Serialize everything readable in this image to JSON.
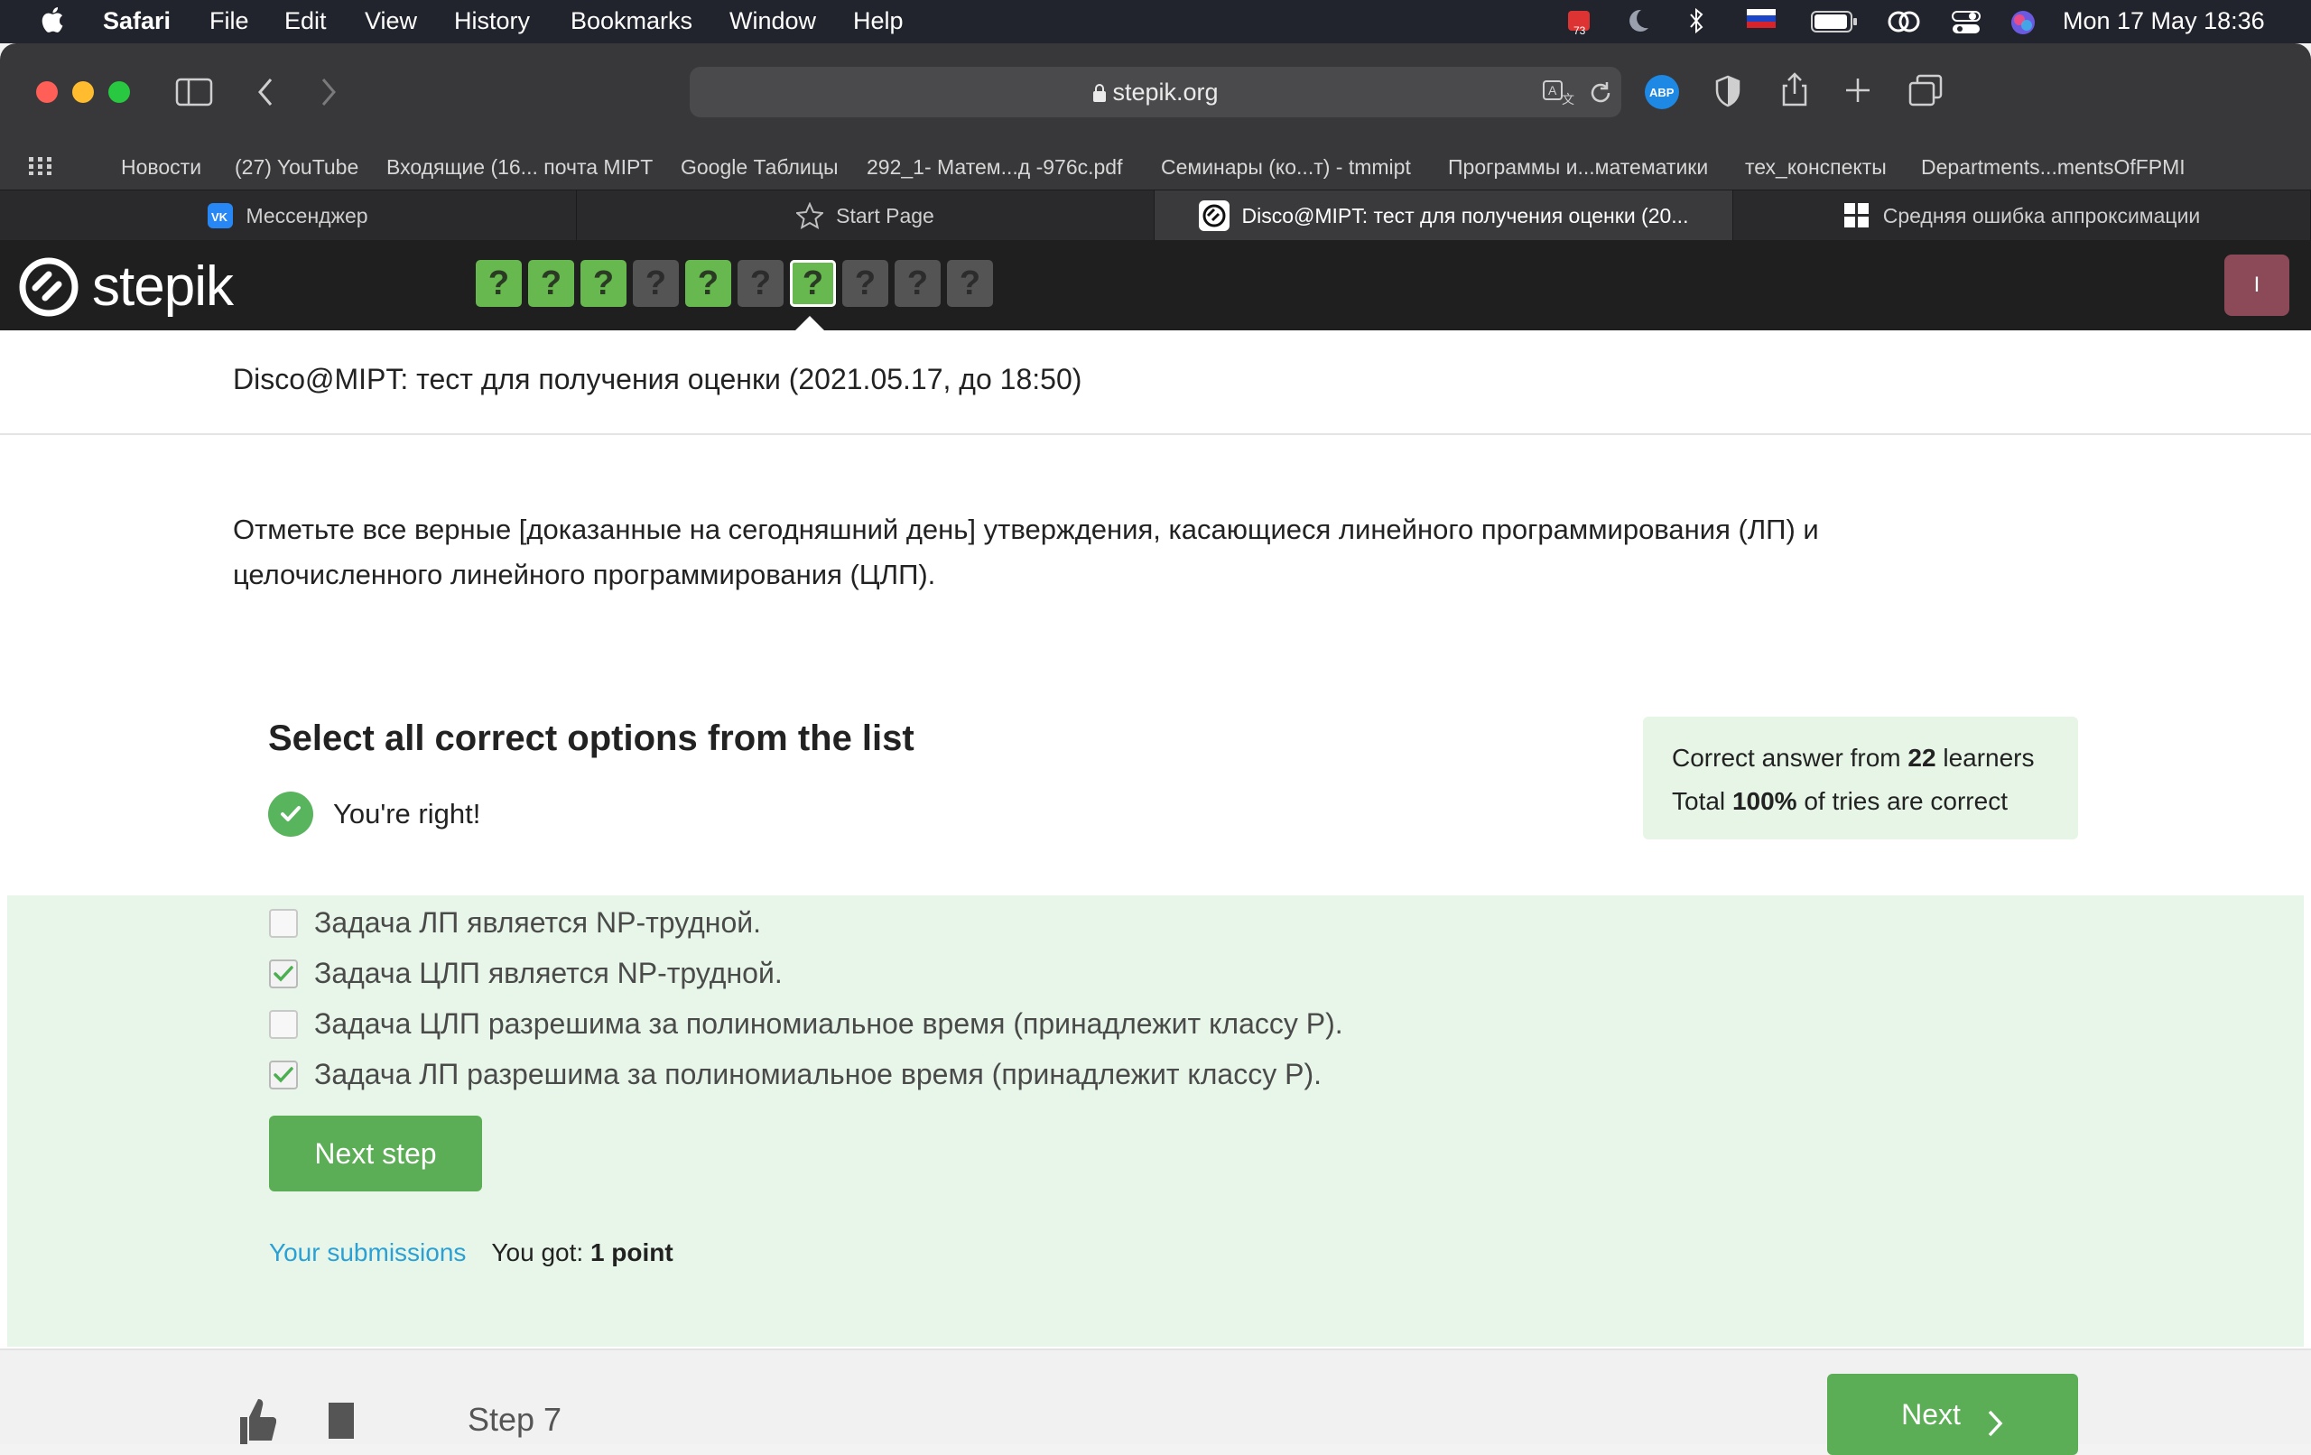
{
  "menubar": {
    "app": "Safari",
    "items": [
      "File",
      "Edit",
      "View",
      "History",
      "Bookmarks",
      "Window",
      "Help"
    ],
    "datetime": "Mon 17 May  18:36"
  },
  "browser": {
    "url": "stepik.org",
    "bookmarks": [
      "Новости",
      "(27) YouTube",
      "Входящие (16... почта MIPT",
      "Google Таблицы",
      "292_1- Матем...д -976c.pdf",
      "Семинары (ко...т) - tmmipt",
      "Программы и...математики",
      "тех_конспекты",
      "Departments...mentsOfFPMI"
    ],
    "tabs": [
      {
        "label": "Мессенджер",
        "icon": "vk-icon"
      },
      {
        "label": "Start Page",
        "icon": "star-icon"
      },
      {
        "label": "Disco@MIPT: тест для получения оценки (20...",
        "icon": "stepik-icon"
      },
      {
        "label": "Средняя ошибка аппроксимации",
        "icon": "grid-icon"
      }
    ]
  },
  "stepik": {
    "logo": "stepik",
    "step_marks": [
      "?",
      "?",
      "?",
      "?",
      "?",
      "?",
      "?",
      "?",
      "?",
      "?"
    ],
    "step_status": [
      "done",
      "done",
      "done",
      "todo",
      "done",
      "todo",
      "current",
      "todo",
      "todo",
      "todo"
    ],
    "avatar_letter": "I",
    "lesson_title": "Disco@MIPT: тест для получения оценки (2021.05.17, до 18:50)",
    "question_line1": "Отметьте все верные [доказанные на сегодняшний день] утверждения, касающиеся линейного программирования (ЛП) и",
    "question_line2": "целочисленного линейного программирования (ЦЛП).",
    "quiz_title": "Select all correct options from the list",
    "result_text": "You're right!",
    "stats": {
      "line1_prefix": "Correct answer from ",
      "line1_count": "22",
      "line1_suffix": " learners",
      "line2_prefix": "Total ",
      "line2_percent": "100%",
      "line2_suffix": " of tries are correct"
    },
    "options": [
      {
        "text": "Задача ЛП является NP-трудной.",
        "checked": false
      },
      {
        "text": "Задача ЦЛП является NP-трудной.",
        "checked": true
      },
      {
        "text": "Задача ЦЛП разрешима за полиномиальное время (принадлежит классу P).",
        "checked": false
      },
      {
        "text": "Задача ЛП разрешима за полиномиальное время (принадлежит классу P).",
        "checked": true
      }
    ],
    "next_step_label": "Next step",
    "submissions_link": "Your submissions",
    "score_prefix": "You got: ",
    "score_value": "1 point",
    "footer_step": "Step 7",
    "next_label": "Next"
  },
  "colors": {
    "accent_green": "#5bae56",
    "success_bg": "#e7f6e8",
    "link": "#2aa0d4"
  }
}
